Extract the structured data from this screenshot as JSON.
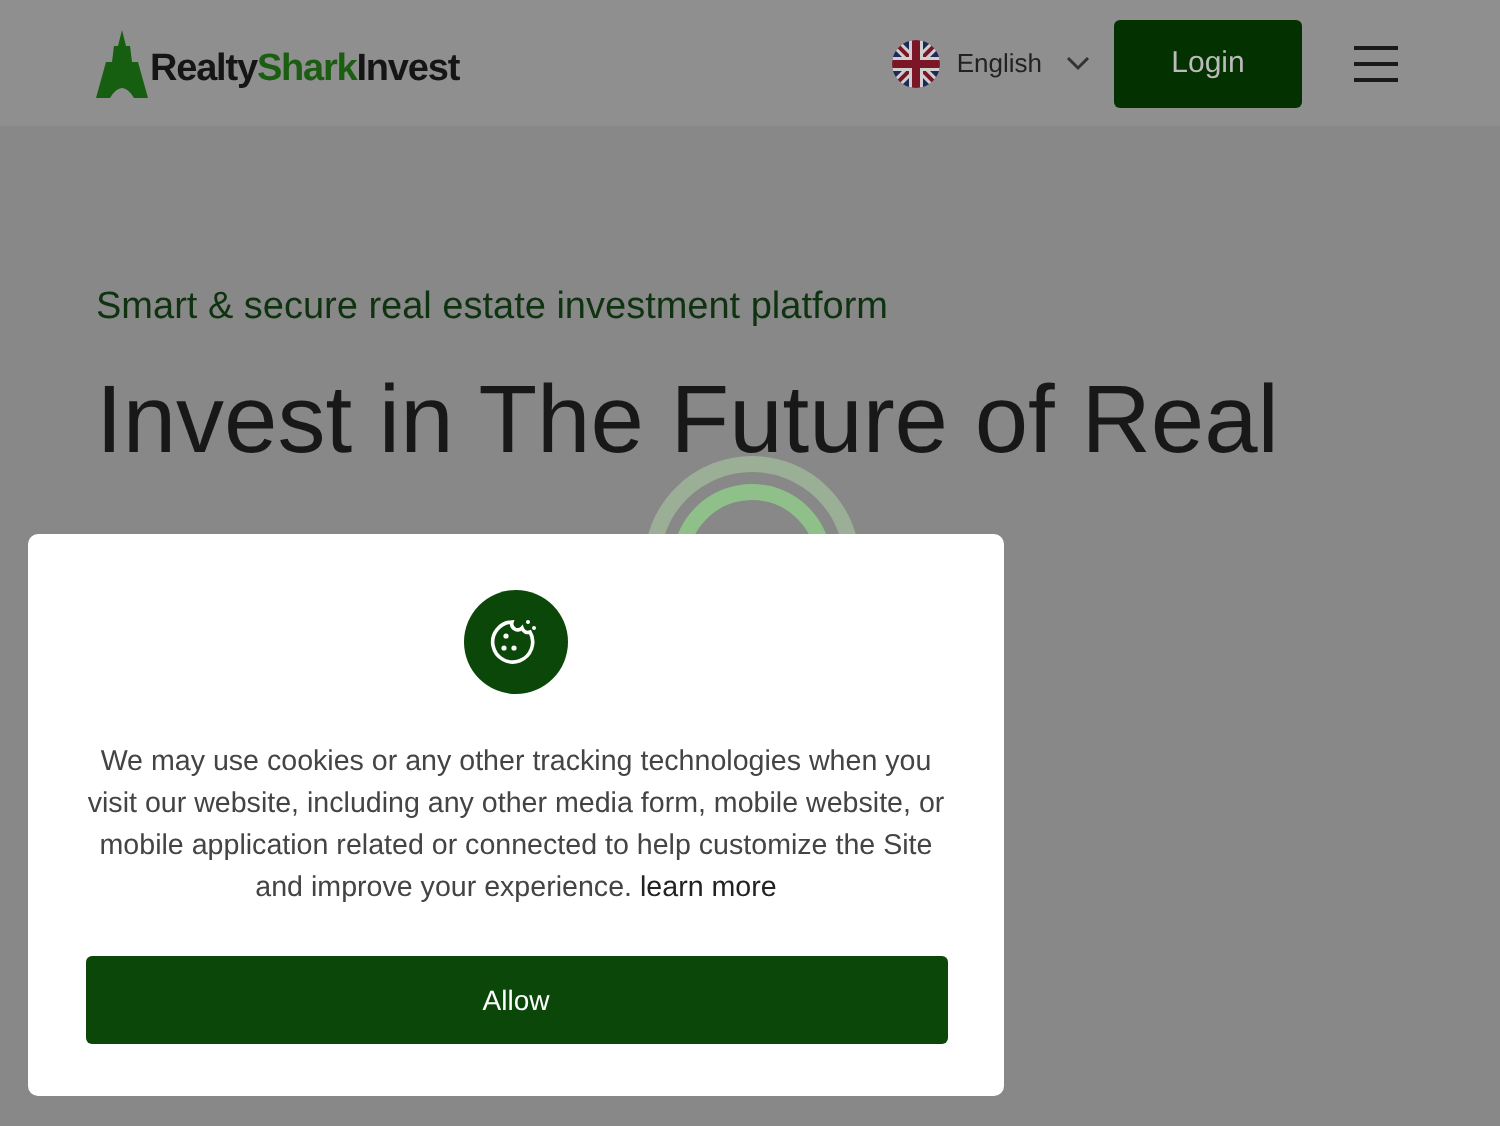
{
  "header": {
    "logo_parts": [
      {
        "text": "Realty",
        "kind": "plain"
      },
      {
        "text": "Shark",
        "kind": "accent"
      },
      {
        "text": "Invest",
        "kind": "plain"
      }
    ],
    "language": "English",
    "login": "Login"
  },
  "hero": {
    "tagline": "Smart & secure real estate investment platform",
    "heading": "Invest in The Future of Real"
  },
  "cookie_dialog": {
    "message": "We may use cookies or any other tracking technologies when you visit our website, including any other media form, mobile website, or mobile application related or connected to help customize the Site and improve your experience.",
    "link": "learn more",
    "button": "Allow"
  }
}
